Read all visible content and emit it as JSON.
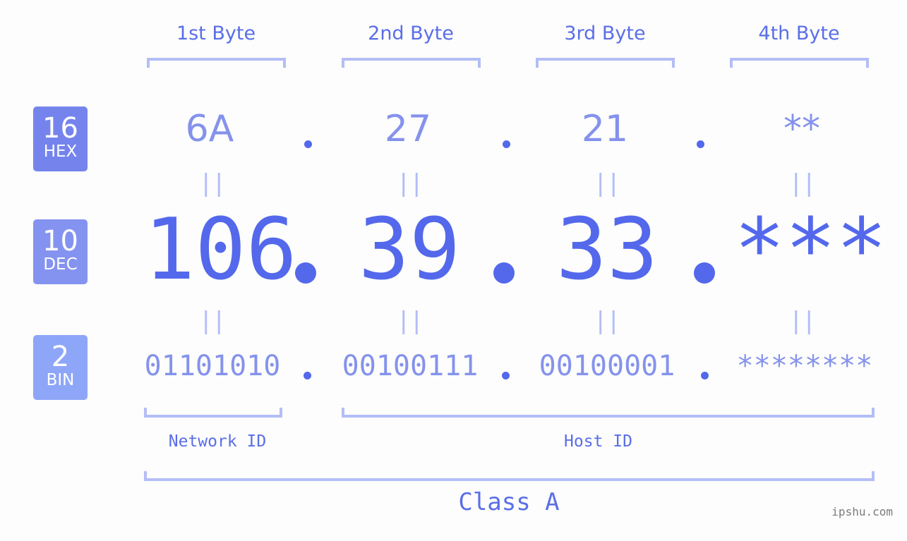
{
  "bytes": [
    {
      "label": "1st Byte",
      "hex": "6A",
      "dec": "106",
      "bin": "01101010"
    },
    {
      "label": "2nd Byte",
      "hex": "27",
      "dec": "39",
      "bin": "00100111"
    },
    {
      "label": "3rd Byte",
      "hex": "21",
      "dec": "33",
      "bin": "00100001"
    },
    {
      "label": "4th Byte",
      "hex": "**",
      "dec": "***",
      "bin": "********"
    }
  ],
  "badges": {
    "hex": {
      "num": "16",
      "sub": "HEX",
      "color": "#7584ec"
    },
    "dec": {
      "num": "10",
      "sub": "DEC",
      "color": "#8593f0"
    },
    "bin": {
      "num": "2",
      "sub": "BIN",
      "color": "#8ea6f8"
    }
  },
  "equals_symbol": "||",
  "network_id_label": "Network ID",
  "host_id_label": "Host ID",
  "class_label": "Class A",
  "watermark": "ipshu.com",
  "colors": {
    "primary": "#5468ec",
    "secondary": "#8592ec",
    "bracket": "#b3bdf7",
    "background": "#fcfdfc"
  }
}
